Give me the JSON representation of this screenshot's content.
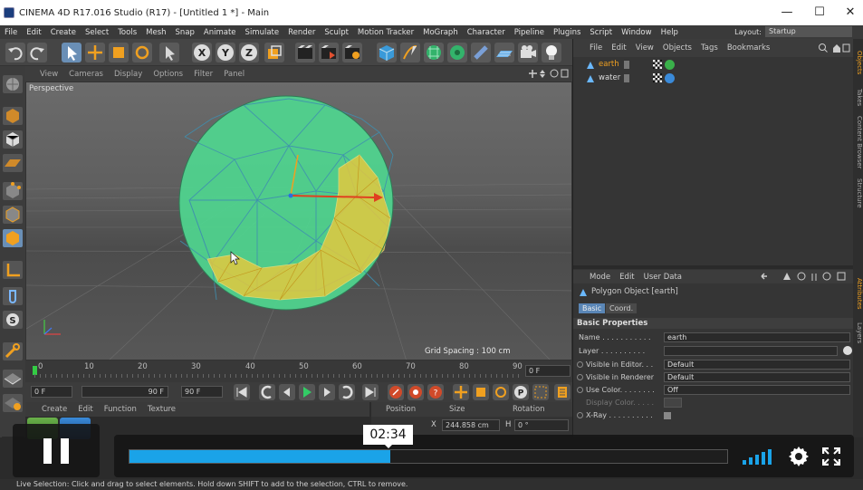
{
  "window": {
    "title": "CINEMA 4D R17.016 Studio (R17) - [Untitled 1 *] - Main",
    "controls": [
      "—",
      "☐",
      "✕"
    ]
  },
  "menubar": {
    "items": [
      "File",
      "Edit",
      "Create",
      "Select",
      "Tools",
      "Mesh",
      "Snap",
      "Animate",
      "Simulate",
      "Render",
      "Sculpt",
      "Motion Tracker",
      "MoGraph",
      "Character",
      "Pipeline",
      "Plugins",
      "Script",
      "Window",
      "Help"
    ],
    "layout_label": "Layout:",
    "layout_value": "Startup"
  },
  "viewport": {
    "menu": [
      "View",
      "Cameras",
      "Display",
      "Options",
      "Filter",
      "Panel"
    ],
    "name": "Perspective",
    "grid_spacing": "Grid Spacing : 100 cm"
  },
  "timeline": {
    "ticks": [
      "0",
      "10",
      "20",
      "30",
      "40",
      "50",
      "60",
      "70",
      "80",
      "90"
    ],
    "frame_end": "0 F"
  },
  "transport": {
    "start": "0 F",
    "mid": "90 F",
    "end": "90 F"
  },
  "materials": {
    "menu": [
      "Create",
      "Edit",
      "Function",
      "Texture"
    ]
  },
  "coordinates": {
    "headers": [
      "Position",
      "Size",
      "Rotation"
    ],
    "row": {
      "size_axis": "X",
      "size_value": "244.858 cm",
      "rot_axis": "H",
      "rot_value": "0 °"
    }
  },
  "object_manager": {
    "menu": [
      "File",
      "Edit",
      "View",
      "Objects",
      "Tags",
      "Bookmarks"
    ],
    "objects": [
      "earth",
      "water"
    ]
  },
  "attributes": {
    "menu": [
      "Mode",
      "Edit",
      "User Data"
    ],
    "object_title": "Polygon Object [earth]",
    "tabs": [
      "Basic",
      "Coord."
    ],
    "section": "Basic Properties",
    "props": [
      {
        "label": "Name . . . . . . . . . . .",
        "value": "earth"
      },
      {
        "label": "Layer . . . . . . . . . .",
        "value": ""
      },
      {
        "label": "Visible in Editor. . .",
        "value": "Default"
      },
      {
        "label": "Visible in Renderer",
        "value": "Default"
      },
      {
        "label": "Use Color. . . . . . . .",
        "value": "Off"
      },
      {
        "label": "Display Color. . . . .",
        "value": ""
      },
      {
        "label": "X-Ray . . . . . . . . . .",
        "value": ""
      }
    ]
  },
  "side_tabs": [
    "Objects",
    "Takes",
    "Content Browser",
    "Structure",
    "Attributes",
    "Layers"
  ],
  "status": "Live Selection: Click and drag to select elements. Hold down SHIFT to add to the selection, CTRL to remove.",
  "player": {
    "time_tooltip": "02:34",
    "progress": 0.436,
    "accent_color": "#1aa3e8"
  },
  "colors": {
    "sphere_fill": "#4fd68f",
    "selection_fill": "#e8c93c",
    "ui_background": "#353535"
  }
}
